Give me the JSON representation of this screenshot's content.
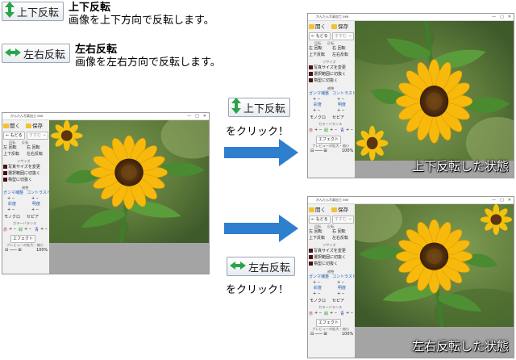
{
  "features": [
    {
      "button_label": "上下反転",
      "title": "上下反転",
      "desc": "画像を上下方向で反転します。"
    },
    {
      "button_label": "左右反転",
      "title": "左右反転",
      "desc": "画像を左右方向で反転します。"
    }
  ],
  "steps": [
    {
      "button_label": "上下反転",
      "click_text": "をクリック！",
      "result": "上下反転した状態"
    },
    {
      "button_label": "左右反転",
      "click_text": "をクリック！",
      "result": "左右反転した状態"
    }
  ],
  "app": {
    "window_title": "かんたん写真加工.exe",
    "window_controls": [
      "—",
      "□",
      "✕"
    ],
    "open": "開く",
    "save": "保存",
    "undo": "← もどる",
    "redo": "すすむ →",
    "rotate_header": "回転",
    "flip_header": "反転",
    "rotate_left": "左 回転",
    "rotate_right": "右 回転",
    "flip_v": "上下反転",
    "flip_h": "左右反転",
    "resize_header": "リサイズ",
    "resize_btn": "写真サイズを変更",
    "crop_btn": "選択範囲に切抜く",
    "shape_btn": "楕型に切抜く",
    "tone_header": "補整",
    "gamma": "ガンマ補整",
    "contrast": "コントラスト",
    "sat": "彩度",
    "bright": "明度",
    "mono": "モノクロ",
    "sepia": "セピア",
    "color_header": "カラーバランス",
    "red": "赤",
    "green": "緑",
    "blue": "青",
    "effect": "エフェクト",
    "zoom": "プレビューの拡大・縮小",
    "fit": "100%"
  },
  "colors": {
    "accent": "#2aa44a",
    "arrow": "#2f7fcf",
    "text_blue": "#1c5fb8"
  }
}
